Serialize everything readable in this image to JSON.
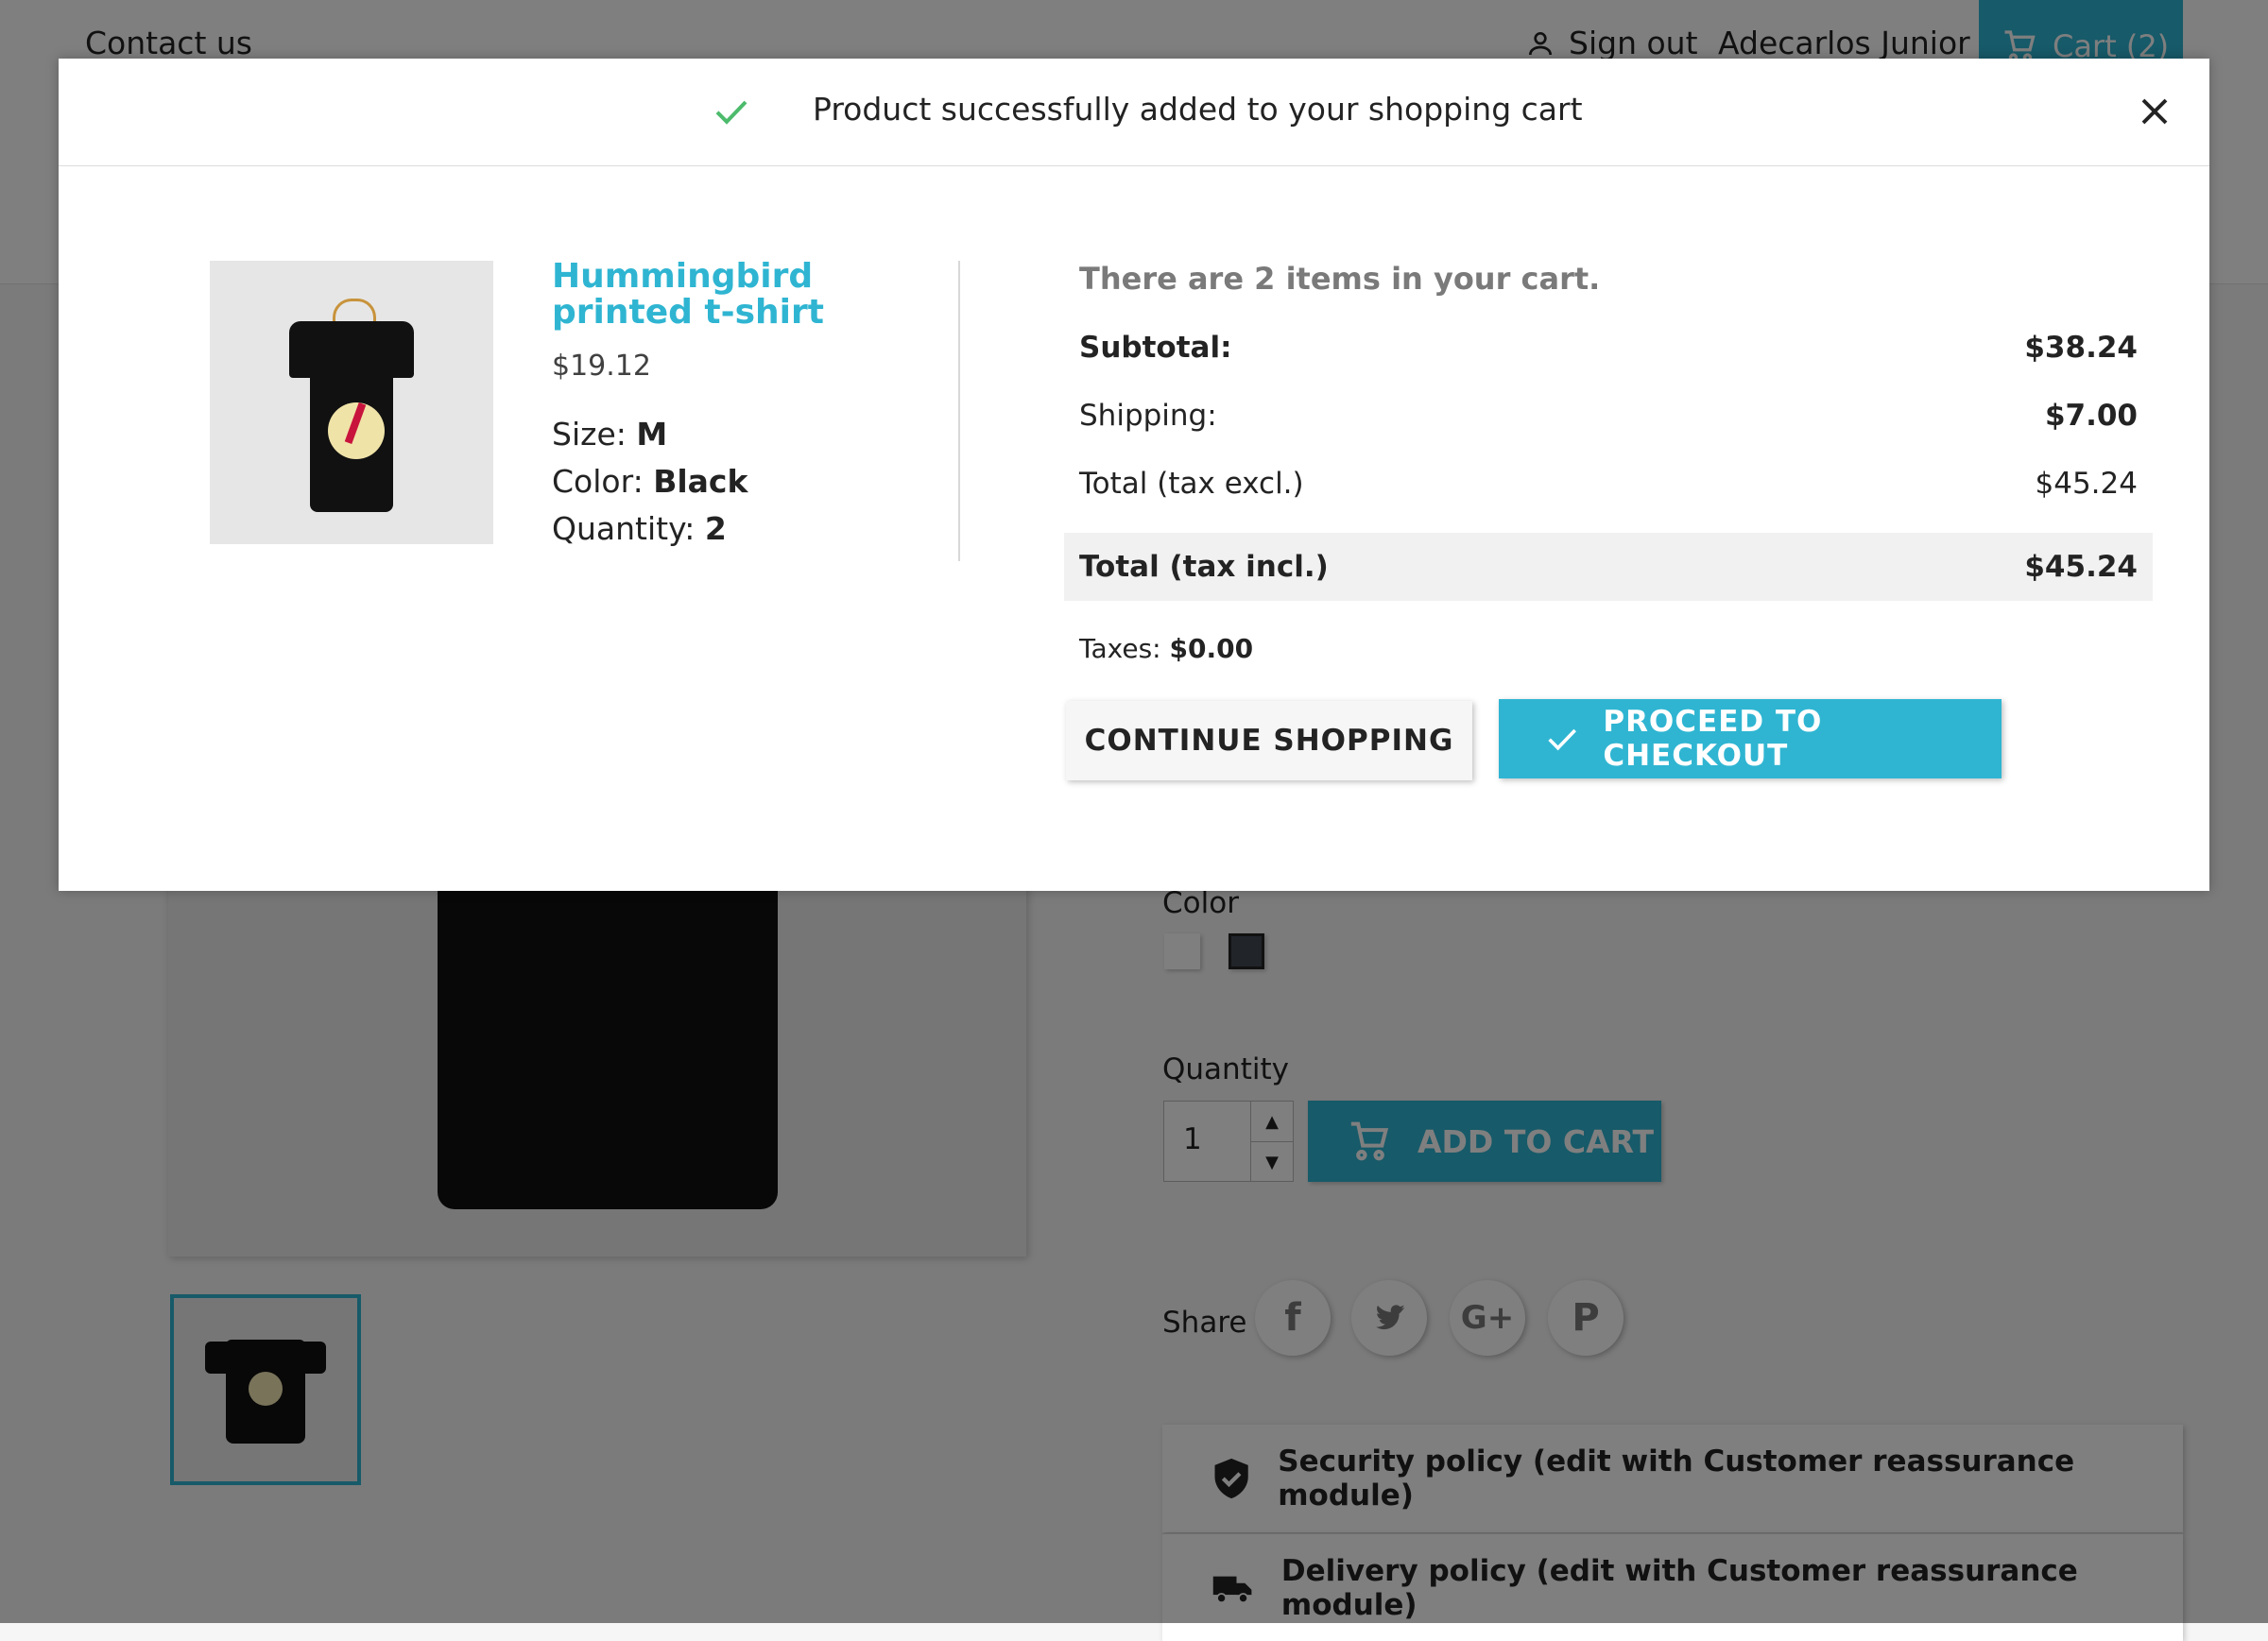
{
  "topbar": {
    "contact": "Contact us",
    "sign_out": "Sign out",
    "username": "Adecarlos Junior",
    "cart": "Cart (2)"
  },
  "product_page": {
    "color_label": "Color",
    "quantity_label": "Quantity",
    "quantity_value": "1",
    "add_to_cart": "ADD TO CART",
    "share_label": "Share",
    "reassurance": [
      "Security policy (edit with Customer reassurance module)",
      "Delivery policy (edit with Customer reassurance module)"
    ]
  },
  "modal": {
    "title": "Product successfully added to your shopping cart",
    "product": {
      "name": "Hummingbird printed t-shirt",
      "price": "$19.12",
      "size_label": "Size:",
      "size": "M",
      "color_label": "Color:",
      "color": "Black",
      "quantity_label": "Quantity:",
      "quantity": "2"
    },
    "cart": {
      "count_text": "There are 2 items in your cart.",
      "subtotal_label": "Subtotal:",
      "subtotal": "$38.24",
      "shipping_label": "Shipping:",
      "shipping": "$7.00",
      "total_excl_label": "Total (tax excl.)",
      "total_excl": "$45.24",
      "total_incl_label": "Total (tax incl.)",
      "total_incl": "$45.24",
      "taxes_label": "Taxes:",
      "taxes": "$0.00"
    },
    "buttons": {
      "continue": "CONTINUE SHOPPING",
      "checkout": "PROCEED TO CHECKOUT"
    }
  },
  "colors": {
    "accent": "#2fb5d2",
    "success": "#4cbb6c",
    "overlay": "rgba(0,0,0,0.5)"
  }
}
